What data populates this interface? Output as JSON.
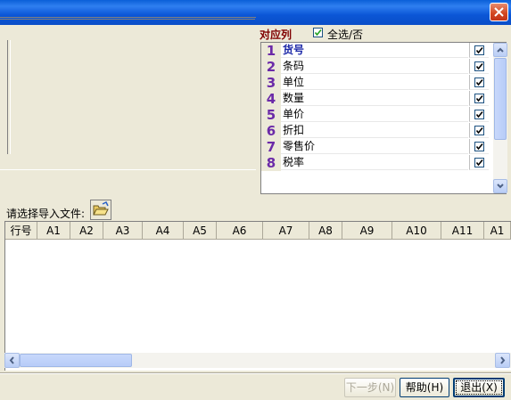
{
  "window": {
    "close_icon": "close-icon"
  },
  "columns_panel": {
    "header": "对应列",
    "select_all_label": "全选/否",
    "rows": [
      {
        "num": "1",
        "name": "货号",
        "checked": true
      },
      {
        "num": "2",
        "name": "条码",
        "checked": true
      },
      {
        "num": "3",
        "name": "单位",
        "checked": true
      },
      {
        "num": "4",
        "name": "数量",
        "checked": true
      },
      {
        "num": "5",
        "name": "单价",
        "checked": true
      },
      {
        "num": "6",
        "name": "折扣",
        "checked": true
      },
      {
        "num": "7",
        "name": "零售价",
        "checked": true
      },
      {
        "num": "8",
        "name": "税率",
        "checked": true
      }
    ]
  },
  "file": {
    "label": "请选择导入文件:",
    "icon": "folder-open-icon"
  },
  "table": {
    "headers": [
      "行号",
      "A1",
      "A2",
      "A3",
      "A4",
      "A5",
      "A6",
      "A7",
      "A8",
      "A9",
      "A10",
      "A11",
      "A1"
    ]
  },
  "footer": {
    "next_label": "下一步(N)",
    "help_label": "帮助(H)",
    "exit_label": "退出(X)"
  }
}
